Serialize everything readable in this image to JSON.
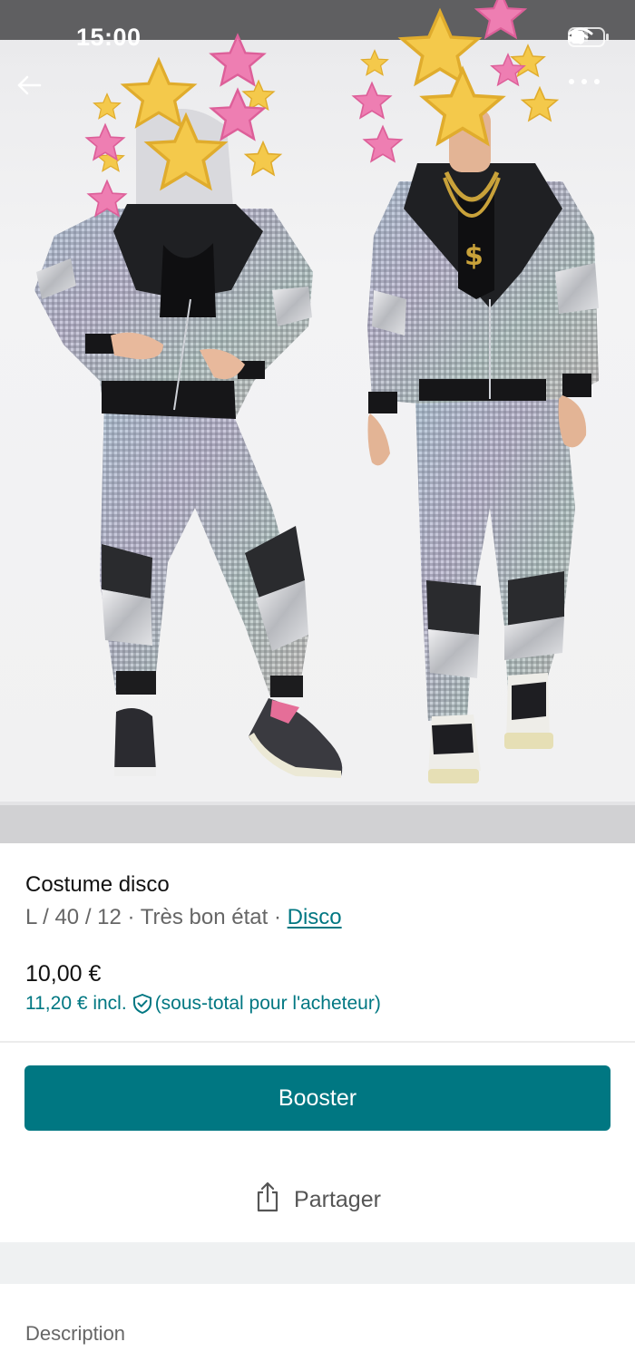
{
  "status_bar": {
    "time": "15:00"
  },
  "nav": {
    "back_icon": "arrow-left-icon",
    "more_icon": "more-horizontal-icon"
  },
  "item": {
    "title": "Costume disco",
    "size": "L / 40 / 12",
    "separator": " · ",
    "condition": "Très bon état",
    "brand": "Disco",
    "price": "10,00 €",
    "buyer_price": "11,20 € incl.",
    "buyer_price_note": "(sous-total pour l'acheteur)"
  },
  "actions": {
    "boost_label": "Booster",
    "share_label": "Partager"
  },
  "sections": {
    "description_label": "Description"
  },
  "colors": {
    "accent": "#007782",
    "text_secondary": "#666666"
  }
}
